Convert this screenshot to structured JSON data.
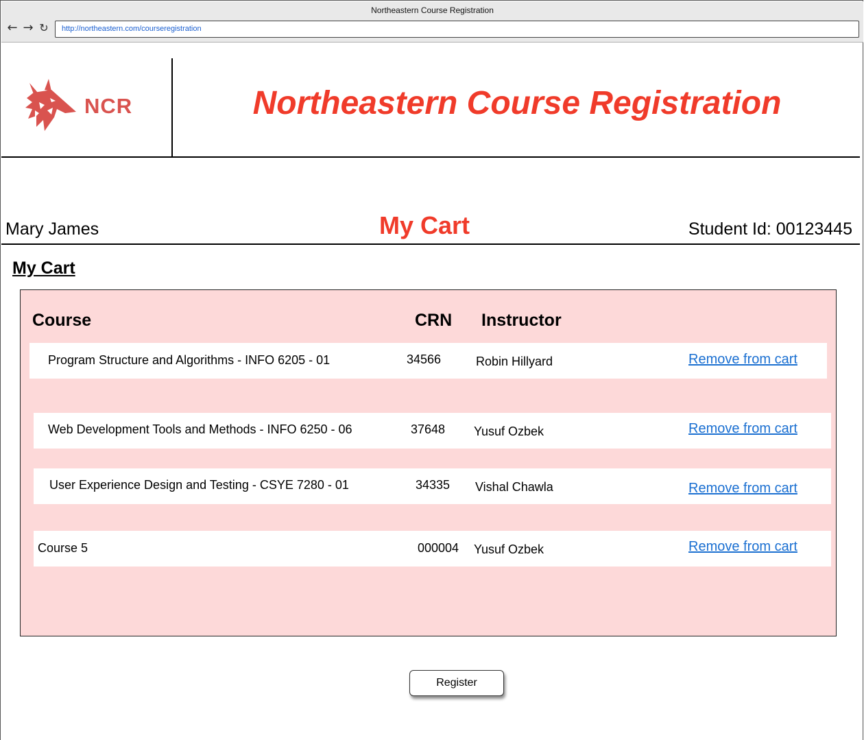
{
  "browser": {
    "window_title": "Northeastern Course Registration",
    "url": "http://northeastern.com/courseregistration",
    "back_icon": "arrow-left-icon",
    "forward_icon": "arrow-right-icon",
    "reload_icon": "reload-icon"
  },
  "header": {
    "logo_text": "NCR",
    "logo_icon": "wolf-icon",
    "title": "Northeastern Course Registration",
    "accent_color": "#f03b2a",
    "logo_color": "#d9534f"
  },
  "user_bar": {
    "name": "Mary James",
    "page_heading": "My Cart",
    "student_id": "Student Id: 00123445"
  },
  "cart": {
    "section_title": "My Cart",
    "panel_color": "#fdd9d9",
    "columns": {
      "course": "Course",
      "crn": "CRN",
      "instructor": "Instructor"
    },
    "rows": [
      {
        "course": "Program Structure and Algorithms - INFO 6205 - 01",
        "crn": "34566",
        "instructor": "Robin Hillyard",
        "action": "Remove from cart"
      },
      {
        "course": "Web Development Tools and Methods - INFO 6250 - 06",
        "crn": "37648",
        "instructor": "Yusuf Ozbek",
        "action": "Remove from cart"
      },
      {
        "course": "User Experience Design and Testing - CSYE 7280 - 01",
        "crn": "34335",
        "instructor": "Vishal Chawla",
        "action": "Remove from cart"
      },
      {
        "course": "Course 5",
        "crn": "000004",
        "instructor": "Yusuf Ozbek",
        "action": "Remove from cart"
      }
    ]
  },
  "register_label": "Register"
}
